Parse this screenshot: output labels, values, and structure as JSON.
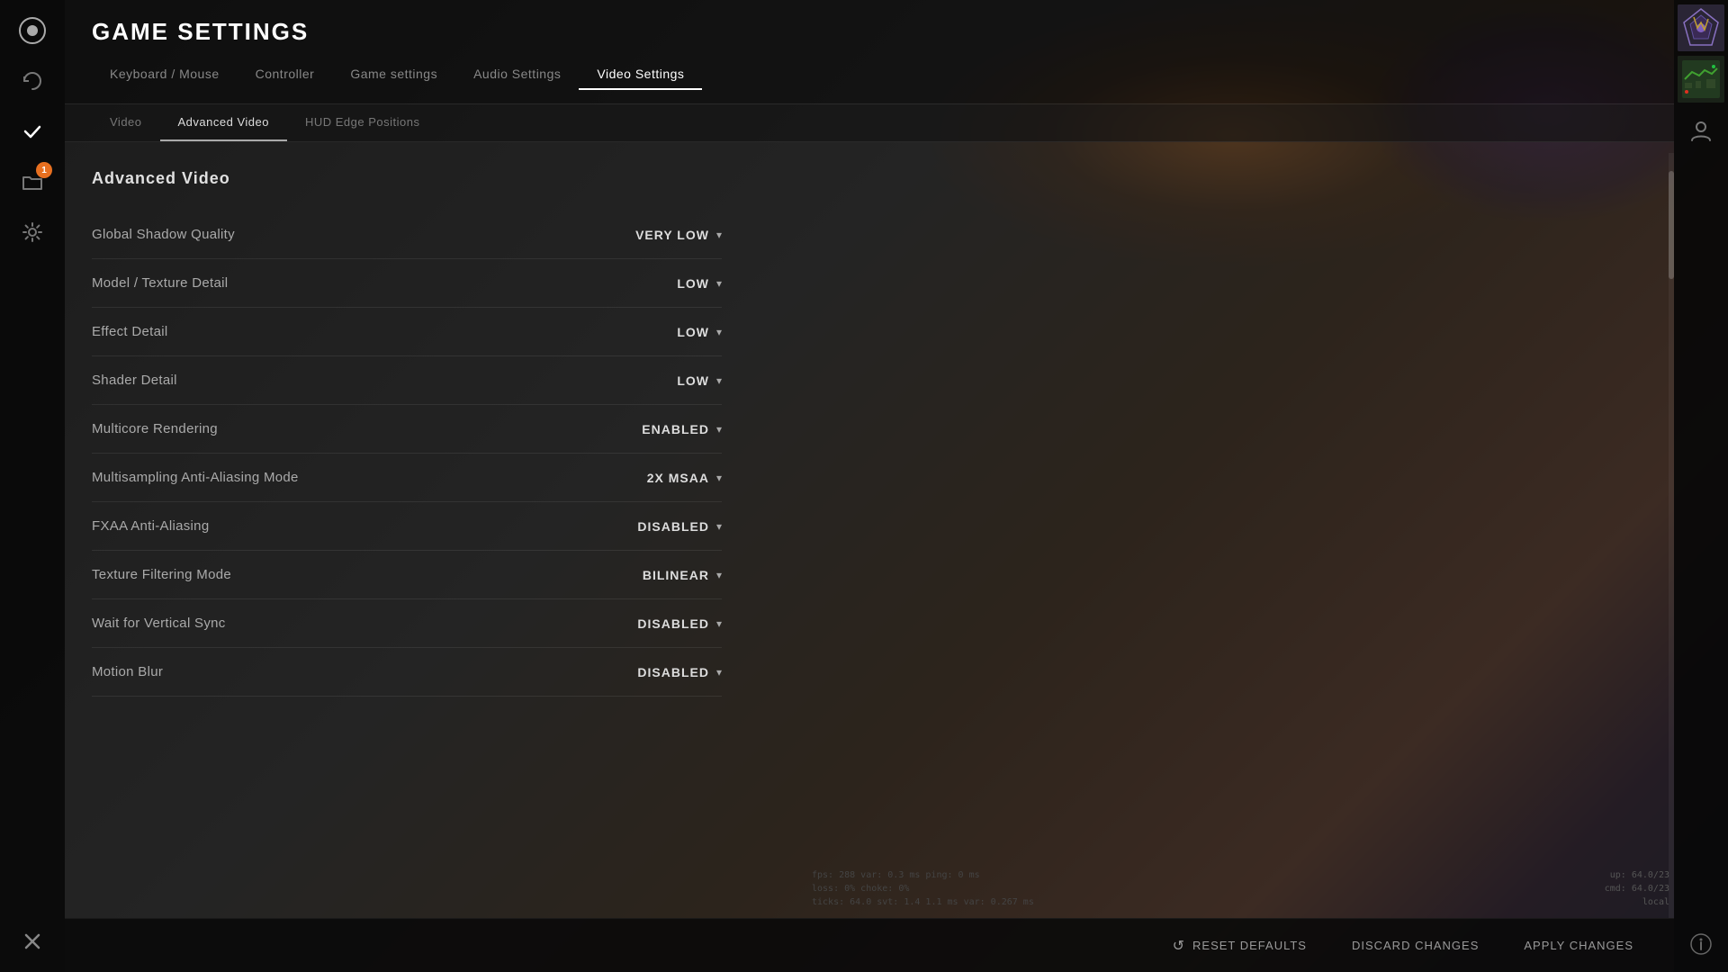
{
  "page": {
    "title": "GAME SETTINGS"
  },
  "nav": {
    "tabs": [
      {
        "id": "keyboard",
        "label": "Keyboard / Mouse",
        "active": false
      },
      {
        "id": "controller",
        "label": "Controller",
        "active": false
      },
      {
        "id": "game",
        "label": "Game settings",
        "active": false
      },
      {
        "id": "audio",
        "label": "Audio Settings",
        "active": false
      },
      {
        "id": "video",
        "label": "Video Settings",
        "active": true
      }
    ],
    "sub_tabs": [
      {
        "id": "video",
        "label": "Video",
        "active": false
      },
      {
        "id": "advanced",
        "label": "Advanced Video",
        "active": true
      },
      {
        "id": "hud",
        "label": "HUD Edge Positions",
        "active": false
      }
    ]
  },
  "section": {
    "title": "Advanced Video"
  },
  "settings": [
    {
      "id": "global-shadow",
      "label": "Global Shadow Quality",
      "value": "VERY LOW"
    },
    {
      "id": "model-texture",
      "label": "Model / Texture Detail",
      "value": "LOW"
    },
    {
      "id": "effect-detail",
      "label": "Effect Detail",
      "value": "LOW"
    },
    {
      "id": "shader-detail",
      "label": "Shader Detail",
      "value": "LOW"
    },
    {
      "id": "multicore",
      "label": "Multicore Rendering",
      "value": "ENABLED"
    },
    {
      "id": "msaa",
      "label": "Multisampling Anti-Aliasing Mode",
      "value": "2X MSAA"
    },
    {
      "id": "fxaa",
      "label": "FXAA Anti-Aliasing",
      "value": "DISABLED"
    },
    {
      "id": "texture-filter",
      "label": "Texture Filtering Mode",
      "value": "BILINEAR"
    },
    {
      "id": "vsync",
      "label": "Wait for Vertical Sync",
      "value": "DISABLED"
    },
    {
      "id": "motion-blur",
      "label": "Motion Blur",
      "value": "DISABLED"
    }
  ],
  "bottom": {
    "reset_label": "RESET DEFAULTS",
    "discard_label": "DISCARD CHANGES",
    "apply_label": "APPLY CHANGES"
  },
  "debug": {
    "line1": "fps: 288  var: 0.3 ms  ping: 0 ms",
    "line2": "loss: 0%  choke: 0%",
    "line3": "ticks: 64.0  svt: 1.4  1.1 ms  var: 0.267 ms",
    "line4": "local"
  },
  "debug_right": {
    "line1": "up: 64.0/23",
    "line2": "cmd: 64.0/23",
    "line3": "local"
  },
  "badge_count": "1",
  "icons": {
    "sidebar_circle": "◉",
    "sidebar_sync": "⟳",
    "sidebar_check": "✓",
    "sidebar_folder": "🗂",
    "sidebar_gear": "⚙",
    "sidebar_close": "✕",
    "reset_icon": "↺",
    "dropdown": "▾",
    "right_user": "👤",
    "right_info": "ⓘ"
  }
}
